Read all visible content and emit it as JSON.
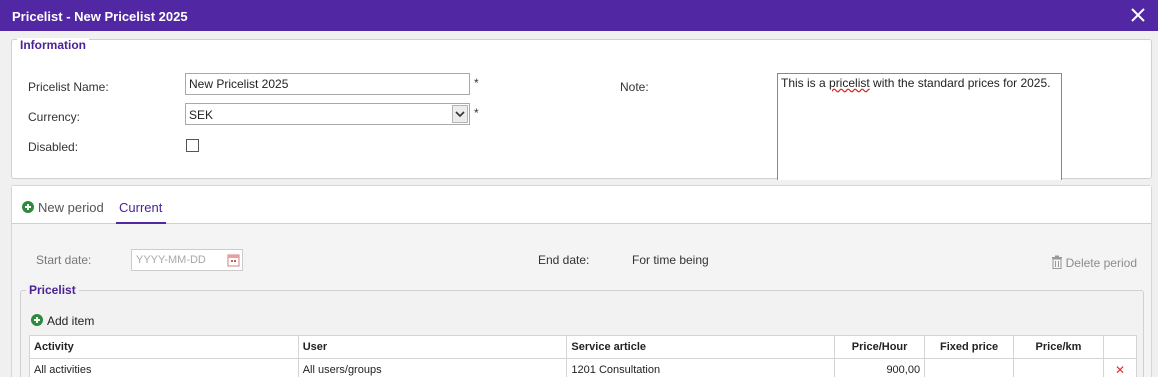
{
  "window": {
    "title": "Pricelist - New Pricelist 2025"
  },
  "information": {
    "legend": "Information",
    "name_label": "Pricelist Name:",
    "name_value": "New Pricelist 2025",
    "currency_label": "Currency:",
    "currency_value": "SEK",
    "disabled_label": "Disabled:",
    "disabled_checked": false,
    "required_mark": "*",
    "note_label": "Note:",
    "note_pre": "This is a ",
    "note_misspelled": "pricelist",
    "note_post": " with the standard prices for 2025."
  },
  "period": {
    "tab_new": "New period",
    "tab_current": "Current",
    "start_label": "Start date:",
    "start_placeholder": "YYYY-MM-DD",
    "end_label": "End date:",
    "end_value": "For time being",
    "delete_label": "Delete period"
  },
  "pricelist": {
    "legend": "Pricelist",
    "add_item": "Add item",
    "columns": {
      "activity": "Activity",
      "user": "User",
      "service": "Service article",
      "price_hour": "Price/Hour",
      "fixed": "Fixed price",
      "price_km": "Price/km"
    },
    "rows": [
      {
        "activity": "All activities",
        "user": "All users/groups",
        "service": "1201 Consultation",
        "price_hour": "900,00",
        "fixed": "",
        "price_km": "",
        "delete": "✕"
      }
    ]
  },
  "colors": {
    "title_bar": "#5127a3",
    "accent": "#4b2396",
    "add_green": "#2e8b3e",
    "delete_red": "#e03030"
  },
  "icons": {
    "close": "close-icon",
    "add": "plus-circle-icon",
    "calendar": "calendar-icon",
    "trash": "trash-icon",
    "dropdown": "chevron-down-icon"
  }
}
